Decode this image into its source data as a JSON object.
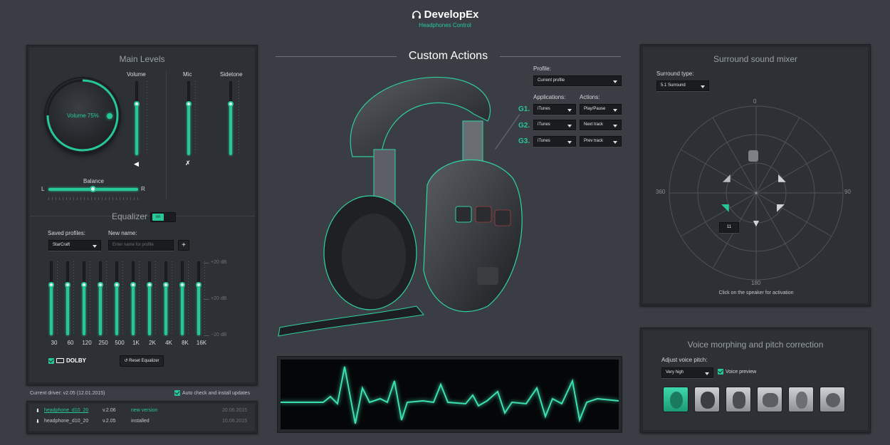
{
  "header": {
    "brand": "DevelopEx",
    "subtitle": "Headphones Control"
  },
  "main_levels": {
    "title": "Main Levels",
    "volume_label": "Volume",
    "mic_label": "Mic",
    "sidetone_label": "Sidetone",
    "dial_text": "Volume 75%",
    "volume_level": 0.75,
    "balance_label": "Balance",
    "balance_left": "L",
    "balance_right": "R"
  },
  "equalizer": {
    "title": "Equalizer",
    "toggle": "on",
    "saved_profiles_label": "Saved profiles:",
    "saved_profile_value": "StarCraft",
    "new_name_label": "New name:",
    "new_name_placeholder": "Enter name for profile",
    "add_label": "+",
    "db_top": "+20 dB",
    "db_mid": "+20 dB",
    "db_bot": "−20 dB",
    "bands": [
      "30",
      "60",
      "120",
      "250",
      "500",
      "1K",
      "2K",
      "4K",
      "8K",
      "16K"
    ],
    "dolby_label": "DOLBY",
    "reset_label": "Reset Equalizer"
  },
  "driver": {
    "current": "Current driver: v2.05 (12.01.2015)",
    "auto_check_label": "Auto check and install updates",
    "rows": [
      {
        "name": "headphone_d10_20",
        "version": "v.2.06",
        "status": "new version",
        "date": "20.06.2015"
      },
      {
        "name": "headphone_d10_20",
        "version": "v.2.05",
        "status": "installed",
        "date": "10.06.2015"
      }
    ]
  },
  "custom_actions": {
    "title": "Custom Actions",
    "profile_label": "Profile:",
    "profile_value": "Current profile",
    "applications_label": "Applications:",
    "actions_label": "Actions:",
    "rows": [
      {
        "key": "G1.",
        "app": "iTunes",
        "action": "Play/Pause"
      },
      {
        "key": "G2.",
        "app": "iTunes",
        "action": "Next track"
      },
      {
        "key": "G3.",
        "app": "iTunes",
        "action": "Prev track"
      }
    ]
  },
  "surround": {
    "title": "Surround sound mixer",
    "type_label": "Surround type:",
    "type_value": "5.1 Surround",
    "deg_top": "0",
    "deg_right": "90",
    "deg_bottom": "180",
    "deg_left": "360",
    "active_value": "11",
    "hint": "Click on the speaker for activation"
  },
  "voice": {
    "title": "Voice morphing and pitch correction",
    "pitch_label": "Adjust voice pitch:",
    "pitch_value": "Very high",
    "preview_label": "Voice preview"
  },
  "colors": {
    "accent": "#28c79a",
    "panel": "#2d3035",
    "background": "#3a3e44"
  }
}
